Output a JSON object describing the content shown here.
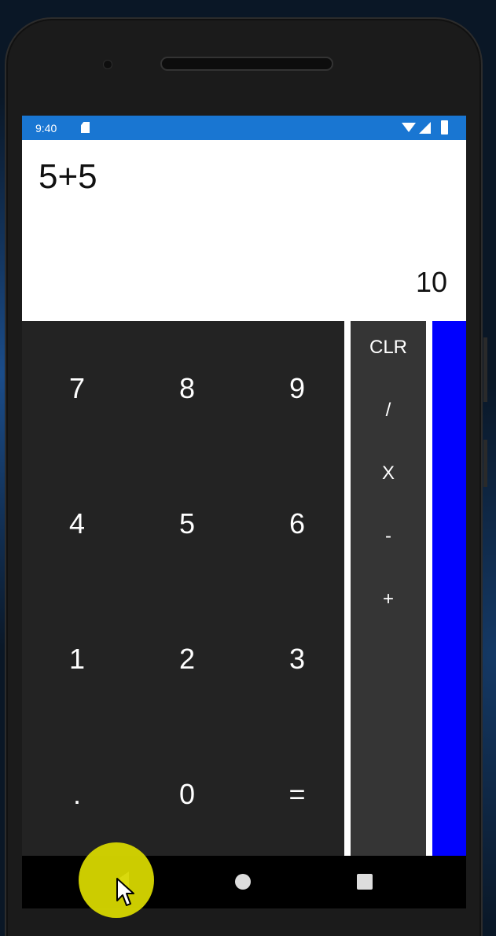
{
  "status_bar": {
    "time": "9:40",
    "icons": [
      "sd-card-icon",
      "wifi-icon",
      "signal-icon",
      "battery-icon"
    ]
  },
  "display": {
    "expression": "5+5",
    "result": "10"
  },
  "keypad": {
    "rows": [
      [
        "7",
        "8",
        "9"
      ],
      [
        "4",
        "5",
        "6"
      ],
      [
        "1",
        "2",
        "3"
      ],
      [
        ".",
        "0",
        "="
      ]
    ]
  },
  "operators": [
    "CLR",
    "/",
    "X",
    "-",
    "+"
  ],
  "nav_bar": {
    "icons": [
      "back-icon",
      "home-icon",
      "recents-icon"
    ]
  },
  "colors": {
    "status_bar": "#1976d2",
    "keypad_bg": "#232323",
    "operator_bg": "#353535",
    "accent_panel": "#0000ff",
    "tap_indicator": "#d7d700"
  }
}
